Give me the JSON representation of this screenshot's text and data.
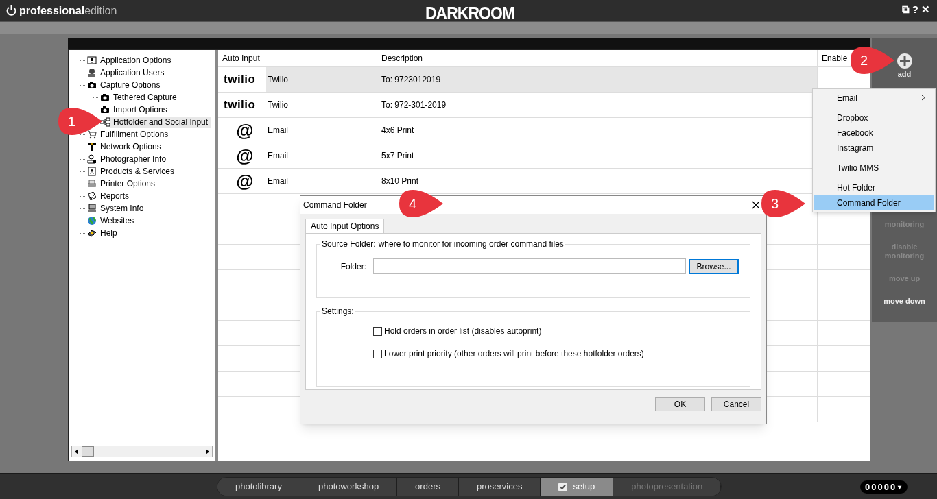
{
  "title_bar": {
    "edition_bold": "professional",
    "edition_light": "edition",
    "logo": "DARKROOM",
    "controls": [
      "_",
      "⧉",
      "?",
      "✕"
    ]
  },
  "tree": [
    {
      "label": "Application Options",
      "selected": false
    },
    {
      "label": "Application Users",
      "selected": false
    },
    {
      "label": "Capture Options",
      "selected": false,
      "children": [
        {
          "label": "Tethered Capture",
          "selected": false
        },
        {
          "label": "Import Options",
          "selected": false
        },
        {
          "label": "Hotfolder and Social Input",
          "selected": true
        }
      ]
    },
    {
      "label": "Fulfillment Options",
      "selected": false
    },
    {
      "label": "Network Options",
      "selected": false
    },
    {
      "label": "Photographer Info",
      "selected": false
    },
    {
      "label": "Products & Services",
      "selected": false
    },
    {
      "label": "Printer Options",
      "selected": false
    },
    {
      "label": "Reports",
      "selected": false
    },
    {
      "label": "System Info",
      "selected": false
    },
    {
      "label": "Websites",
      "selected": false
    },
    {
      "label": "Help",
      "selected": false
    }
  ],
  "table": {
    "columns": [
      "Auto Input",
      "Description",
      "Enable"
    ],
    "rows": [
      {
        "kind": "twilio",
        "logo": "twilio",
        "name": "Twilio",
        "description": "To: 9723012019",
        "selected": true
      },
      {
        "kind": "twilio",
        "logo": "twilio",
        "name": "Twilio",
        "description": "To: 972-301-2019",
        "selected": false
      },
      {
        "kind": "email",
        "logo": "@",
        "name": "Email",
        "description": "4x6 Print",
        "selected": false
      },
      {
        "kind": "email",
        "logo": "@",
        "name": "Email",
        "description": "5x7 Print",
        "selected": false
      },
      {
        "kind": "email",
        "logo": "@",
        "name": "Email",
        "description": "8x10 Print",
        "selected": false
      }
    ]
  },
  "sidebar_actions": [
    {
      "kind": "add",
      "label": "add",
      "disabled": false
    },
    {
      "kind": "hidden",
      "label": "monitoring",
      "disabled": true
    },
    {
      "kind": "text",
      "label": "disable monitoring",
      "disabled": true
    },
    {
      "kind": "text",
      "label": "move up",
      "disabled": true
    },
    {
      "kind": "text",
      "label": "move down",
      "disabled": false
    }
  ],
  "add_menu": [
    [
      {
        "label": "Email",
        "submenu": true,
        "selected": false
      }
    ],
    [
      {
        "label": "Dropbox",
        "submenu": false,
        "selected": false
      },
      {
        "label": "Facebook",
        "submenu": false,
        "selected": false
      },
      {
        "label": "Instagram",
        "submenu": false,
        "selected": false
      }
    ],
    [
      {
        "label": "Twilio MMS",
        "submenu": false,
        "selected": false
      }
    ],
    [
      {
        "label": "Hot Folder",
        "submenu": false,
        "selected": false
      },
      {
        "label": "Command Folder",
        "submenu": false,
        "selected": true
      }
    ]
  ],
  "dialog": {
    "title": "Command Folder",
    "tabs": [
      {
        "label": "Auto Input Options",
        "selected": true
      }
    ],
    "source_group": {
      "legend": "Source Folder:",
      "hint": "where to monitor for incoming order command files",
      "folder_label": "Folder:",
      "browse": "Browse..."
    },
    "settings_group": {
      "legend": "Settings:",
      "options": [
        {
          "label": "Hold orders in order list (disables autoprint)",
          "checked": false
        },
        {
          "label": "Lower print priority (other orders will print before these hotfolder orders)",
          "checked": false
        }
      ]
    },
    "buttons": [
      "OK",
      "Cancel"
    ]
  },
  "callouts": [
    "1",
    "2",
    "3",
    "4"
  ],
  "bottom_tabs": [
    {
      "label": "photolibrary",
      "selected": false,
      "disabled": false
    },
    {
      "label": "photoworkshop",
      "selected": false,
      "disabled": false
    },
    {
      "label": "orders",
      "selected": false,
      "disabled": false
    },
    {
      "label": "proservices",
      "selected": false,
      "disabled": false
    },
    {
      "label": "setup",
      "selected": true,
      "disabled": false
    },
    {
      "label": "photopresentation",
      "selected": false,
      "disabled": true
    }
  ],
  "counter": {
    "value": "00000",
    "caret": "▾"
  }
}
